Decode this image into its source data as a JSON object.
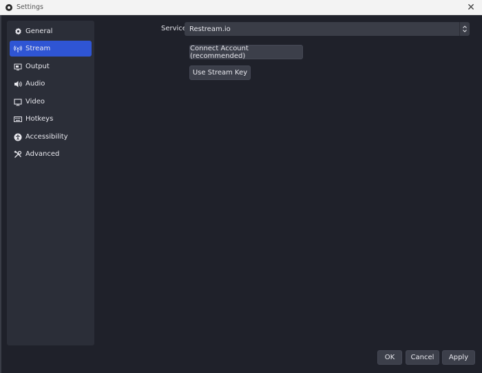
{
  "window": {
    "title": "Settings",
    "close_glyph": "✕",
    "app_icon": "obs-logo-icon"
  },
  "sidebar": {
    "items": [
      {
        "label": "General",
        "icon": "gear-icon",
        "active": false
      },
      {
        "label": "Stream",
        "icon": "antenna-icon",
        "active": true
      },
      {
        "label": "Output",
        "icon": "output-monitor-icon",
        "active": false
      },
      {
        "label": "Audio",
        "icon": "speaker-icon",
        "active": false
      },
      {
        "label": "Video",
        "icon": "monitor-icon",
        "active": false
      },
      {
        "label": "Hotkeys",
        "icon": "keyboard-icon",
        "active": false
      },
      {
        "label": "Accessibility",
        "icon": "accessibility-icon",
        "active": false
      },
      {
        "label": "Advanced",
        "icon": "tools-icon",
        "active": false
      }
    ]
  },
  "stream": {
    "service_label": "Service",
    "service_value": "Restream.io",
    "connect_button": "Connect Account (recommended)",
    "stream_key_button": "Use Stream Key"
  },
  "footer": {
    "ok": "OK",
    "cancel": "Cancel",
    "apply": "Apply"
  },
  "colors": {
    "accent": "#2f55d4",
    "background": "#1f212a",
    "sidebar": "#2b2e38",
    "button": "#3c3f4a"
  }
}
